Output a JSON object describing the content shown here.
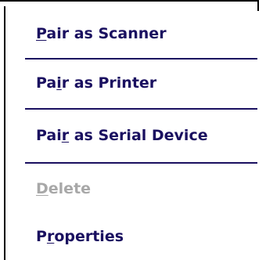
{
  "menu": {
    "items": [
      {
        "pre": "",
        "key": "P",
        "post": "air as Scanner",
        "enabled": true
      },
      {
        "pre": "Pa",
        "key": "i",
        "post": "r as Printer",
        "enabled": true
      },
      {
        "pre": "Pai",
        "key": "r",
        "post": " as Serial Device",
        "enabled": true
      },
      {
        "pre": "",
        "key": "D",
        "post": "elete",
        "enabled": false
      },
      {
        "pre": "P",
        "key": "r",
        "post": "operties",
        "enabled": true
      }
    ]
  },
  "colors": {
    "text": "#1a1060",
    "disabled_text": "#a8a8a8",
    "separator": "#1a1060",
    "border": "#000000",
    "background": "#ffffff"
  }
}
